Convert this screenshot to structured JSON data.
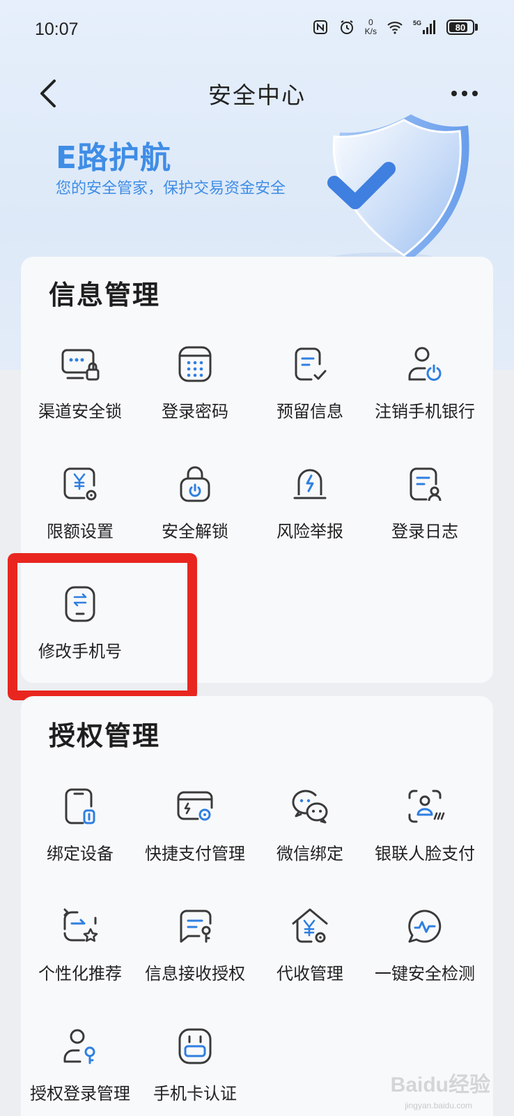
{
  "status_bar": {
    "time": "10:07",
    "speed_value": "0",
    "speed_unit": "K/s",
    "network": "5G",
    "battery": "80"
  },
  "nav": {
    "title": "安全中心"
  },
  "hero": {
    "title": "E路护航",
    "subtitle": "您的安全管家，保护交易资金安全"
  },
  "info_section": {
    "title": "信息管理",
    "items": [
      {
        "label": "渠道安全锁",
        "icon": "channel-lock-icon"
      },
      {
        "label": "登录密码",
        "icon": "keypad-icon"
      },
      {
        "label": "预留信息",
        "icon": "reserved-info-icon"
      },
      {
        "label": "注销手机银行",
        "icon": "user-power-icon"
      },
      {
        "label": "限额设置",
        "icon": "limit-setting-icon"
      },
      {
        "label": "安全解锁",
        "icon": "unlock-icon"
      },
      {
        "label": "风险举报",
        "icon": "alarm-icon"
      },
      {
        "label": "登录日志",
        "icon": "login-log-icon"
      },
      {
        "label": "修改手机号",
        "icon": "phone-change-icon"
      }
    ]
  },
  "auth_section": {
    "title": "授权管理",
    "items": [
      {
        "label": "绑定设备",
        "icon": "bind-device-icon"
      },
      {
        "label": "快捷支付管理",
        "icon": "quick-pay-icon"
      },
      {
        "label": "微信绑定",
        "icon": "wechat-icon"
      },
      {
        "label": "银联人脸支付",
        "icon": "face-pay-icon"
      },
      {
        "label": "个性化推荐",
        "icon": "recommend-icon"
      },
      {
        "label": "信息接收授权",
        "icon": "message-auth-icon"
      },
      {
        "label": "代收管理",
        "icon": "collection-icon"
      },
      {
        "label": "一键安全检测",
        "icon": "security-check-icon"
      },
      {
        "label": "授权登录管理",
        "icon": "auth-login-icon"
      },
      {
        "label": "手机卡认证",
        "icon": "sim-card-icon"
      }
    ]
  },
  "colors": {
    "accent": "#3f8de6",
    "highlight": "#e8261f",
    "icon_stroke": "#3a3a3a",
    "icon_accent": "#2f7fe0"
  },
  "watermark": {
    "text": "Baidu经验",
    "sub": "jingyan.baidu.com"
  }
}
